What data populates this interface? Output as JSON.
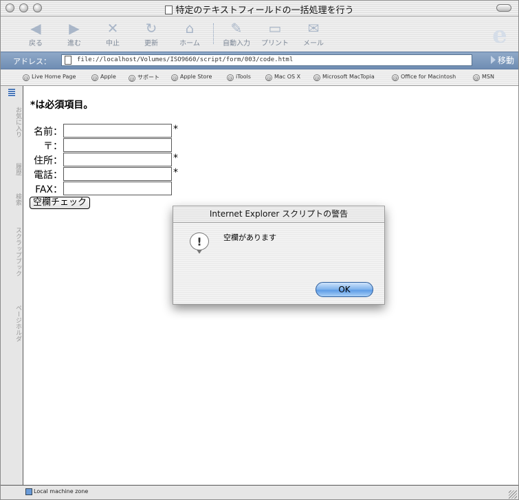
{
  "window": {
    "title": "特定のテキストフィールドの一括処理を行う"
  },
  "toolbar": {
    "back": "戻る",
    "forward": "進む",
    "stop": "中止",
    "refresh": "更新",
    "home": "ホーム",
    "autofill": "自動入力",
    "print": "プリント",
    "mail": "メール"
  },
  "address": {
    "label": "アドレス：",
    "url": "file://localhost/Volumes/ISO9660/script/form/003/code.html",
    "go": "移動"
  },
  "favorites": [
    "Live Home Page",
    "Apple",
    "サポート",
    "Apple Store",
    "iTools",
    "Mac OS X",
    "Microsoft MacTopia",
    "Office for Macintosh",
    "MSN"
  ],
  "sidetabs": [
    "お気に入り",
    "履歴",
    "検索",
    "スクラップブック",
    "ページホルダ"
  ],
  "page": {
    "heading": "*は必須項目。",
    "fields": [
      {
        "label": "名前：",
        "value": "",
        "required": "*"
      },
      {
        "label": "〒：",
        "value": "",
        "required": ""
      },
      {
        "label": "住所：",
        "value": "",
        "required": "*"
      },
      {
        "label": "電話：",
        "value": "",
        "required": "*"
      },
      {
        "label": "FAX：",
        "value": "",
        "required": ""
      }
    ],
    "check_button": "空欄チェック"
  },
  "dialog": {
    "title": "Internet Explorer スクリプトの警告",
    "icon": "!",
    "message": "空欄があります",
    "ok": "OK"
  },
  "status": {
    "zone": "Local machine zone"
  }
}
